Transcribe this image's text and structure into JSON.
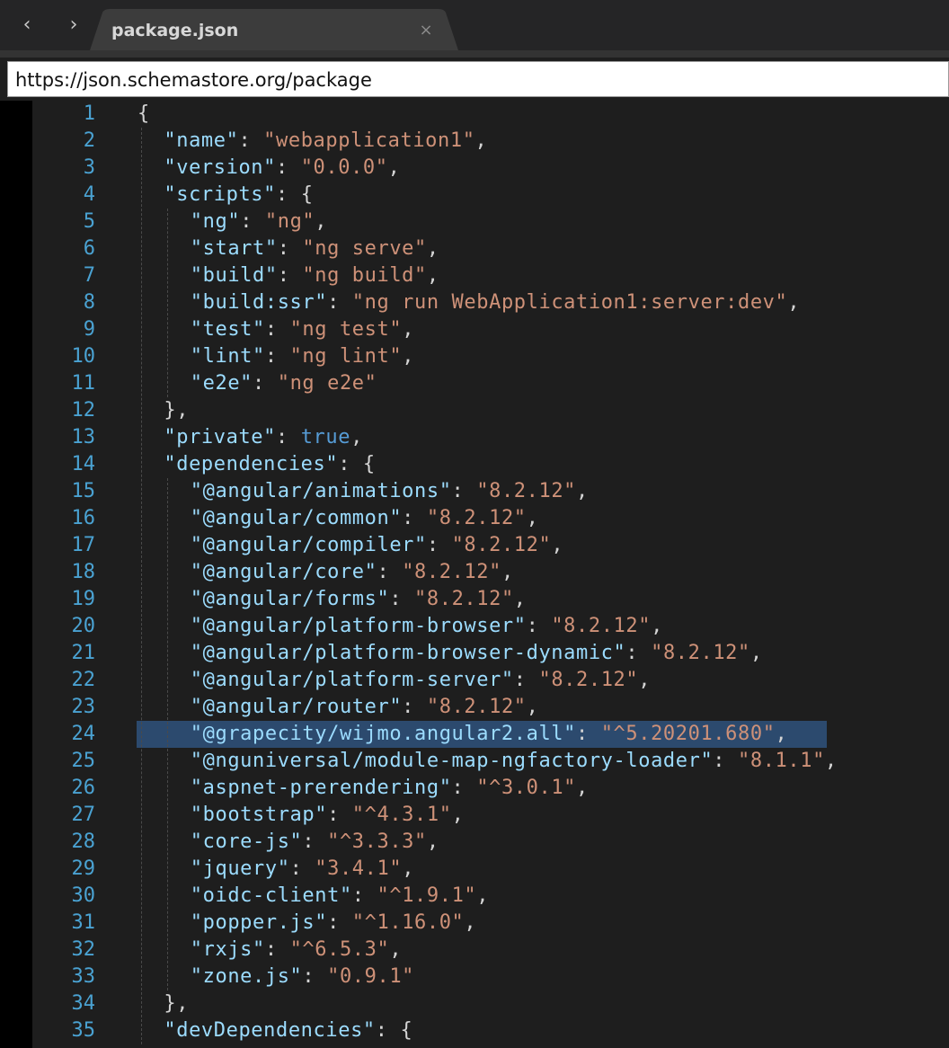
{
  "nav": {
    "back_glyph": "‹",
    "forward_glyph": "›",
    "back_icon": "chevron-left-icon",
    "forward_icon": "chevron-right-icon"
  },
  "tab": {
    "title": "package.json",
    "close_glyph": "×",
    "close_icon": "close-icon"
  },
  "schema_url": "https://json.schemastore.org/package",
  "colors": {
    "key": "#9cdcfe",
    "string": "#ce9178",
    "punct": "#d4d4d4",
    "bool": "#569cd6",
    "line_number": "#4aa2d2",
    "selection": "#2c4a6e",
    "editor_bg": "#1e1e1e"
  },
  "highlighted_line": 24,
  "lines": [
    {
      "n": "1",
      "indent": 0,
      "tokens": [
        {
          "t": "{",
          "c": "p"
        }
      ]
    },
    {
      "n": "2",
      "indent": 1,
      "tokens": [
        {
          "t": "\"name\"",
          "c": "k"
        },
        {
          "t": ": ",
          "c": "p"
        },
        {
          "t": "\"webapplication1\"",
          "c": "s"
        },
        {
          "t": ",",
          "c": "p"
        }
      ]
    },
    {
      "n": "3",
      "indent": 1,
      "tokens": [
        {
          "t": "\"version\"",
          "c": "k"
        },
        {
          "t": ": ",
          "c": "p"
        },
        {
          "t": "\"0.0.0\"",
          "c": "s"
        },
        {
          "t": ",",
          "c": "p"
        }
      ]
    },
    {
      "n": "4",
      "indent": 1,
      "tokens": [
        {
          "t": "\"scripts\"",
          "c": "k"
        },
        {
          "t": ": {",
          "c": "p"
        }
      ]
    },
    {
      "n": "5",
      "indent": 2,
      "tokens": [
        {
          "t": "\"ng\"",
          "c": "k"
        },
        {
          "t": ": ",
          "c": "p"
        },
        {
          "t": "\"ng\"",
          "c": "s"
        },
        {
          "t": ",",
          "c": "p"
        }
      ]
    },
    {
      "n": "6",
      "indent": 2,
      "tokens": [
        {
          "t": "\"start\"",
          "c": "k"
        },
        {
          "t": ": ",
          "c": "p"
        },
        {
          "t": "\"ng serve\"",
          "c": "s"
        },
        {
          "t": ",",
          "c": "p"
        }
      ]
    },
    {
      "n": "7",
      "indent": 2,
      "tokens": [
        {
          "t": "\"build\"",
          "c": "k"
        },
        {
          "t": ": ",
          "c": "p"
        },
        {
          "t": "\"ng build\"",
          "c": "s"
        },
        {
          "t": ",",
          "c": "p"
        }
      ]
    },
    {
      "n": "8",
      "indent": 2,
      "tokens": [
        {
          "t": "\"build:ssr\"",
          "c": "k"
        },
        {
          "t": ": ",
          "c": "p"
        },
        {
          "t": "\"ng run WebApplication1:server:dev\"",
          "c": "s"
        },
        {
          "t": ",",
          "c": "p"
        }
      ]
    },
    {
      "n": "9",
      "indent": 2,
      "tokens": [
        {
          "t": "\"test\"",
          "c": "k"
        },
        {
          "t": ": ",
          "c": "p"
        },
        {
          "t": "\"ng test\"",
          "c": "s"
        },
        {
          "t": ",",
          "c": "p"
        }
      ]
    },
    {
      "n": "10",
      "indent": 2,
      "tokens": [
        {
          "t": "\"lint\"",
          "c": "k"
        },
        {
          "t": ": ",
          "c": "p"
        },
        {
          "t": "\"ng lint\"",
          "c": "s"
        },
        {
          "t": ",",
          "c": "p"
        }
      ]
    },
    {
      "n": "11",
      "indent": 2,
      "tokens": [
        {
          "t": "\"e2e\"",
          "c": "k"
        },
        {
          "t": ": ",
          "c": "p"
        },
        {
          "t": "\"ng e2e\"",
          "c": "s"
        }
      ]
    },
    {
      "n": "12",
      "indent": 1,
      "tokens": [
        {
          "t": "},",
          "c": "p"
        }
      ]
    },
    {
      "n": "13",
      "indent": 1,
      "tokens": [
        {
          "t": "\"private\"",
          "c": "k"
        },
        {
          "t": ": ",
          "c": "p"
        },
        {
          "t": "true",
          "c": "b"
        },
        {
          "t": ",",
          "c": "p"
        }
      ]
    },
    {
      "n": "14",
      "indent": 1,
      "tokens": [
        {
          "t": "\"dependencies\"",
          "c": "k"
        },
        {
          "t": ": {",
          "c": "p"
        }
      ]
    },
    {
      "n": "15",
      "indent": 2,
      "tokens": [
        {
          "t": "\"@angular/animations\"",
          "c": "k"
        },
        {
          "t": ": ",
          "c": "p"
        },
        {
          "t": "\"8.2.12\"",
          "c": "s"
        },
        {
          "t": ",",
          "c": "p"
        }
      ]
    },
    {
      "n": "16",
      "indent": 2,
      "tokens": [
        {
          "t": "\"@angular/common\"",
          "c": "k"
        },
        {
          "t": ": ",
          "c": "p"
        },
        {
          "t": "\"8.2.12\"",
          "c": "s"
        },
        {
          "t": ",",
          "c": "p"
        }
      ]
    },
    {
      "n": "17",
      "indent": 2,
      "tokens": [
        {
          "t": "\"@angular/compiler\"",
          "c": "k"
        },
        {
          "t": ": ",
          "c": "p"
        },
        {
          "t": "\"8.2.12\"",
          "c": "s"
        },
        {
          "t": ",",
          "c": "p"
        }
      ]
    },
    {
      "n": "18",
      "indent": 2,
      "tokens": [
        {
          "t": "\"@angular/core\"",
          "c": "k"
        },
        {
          "t": ": ",
          "c": "p"
        },
        {
          "t": "\"8.2.12\"",
          "c": "s"
        },
        {
          "t": ",",
          "c": "p"
        }
      ]
    },
    {
      "n": "19",
      "indent": 2,
      "tokens": [
        {
          "t": "\"@angular/forms\"",
          "c": "k"
        },
        {
          "t": ": ",
          "c": "p"
        },
        {
          "t": "\"8.2.12\"",
          "c": "s"
        },
        {
          "t": ",",
          "c": "p"
        }
      ]
    },
    {
      "n": "20",
      "indent": 2,
      "tokens": [
        {
          "t": "\"@angular/platform-browser\"",
          "c": "k"
        },
        {
          "t": ": ",
          "c": "p"
        },
        {
          "t": "\"8.2.12\"",
          "c": "s"
        },
        {
          "t": ",",
          "c": "p"
        }
      ]
    },
    {
      "n": "21",
      "indent": 2,
      "tokens": [
        {
          "t": "\"@angular/platform-browser-dynamic\"",
          "c": "k"
        },
        {
          "t": ": ",
          "c": "p"
        },
        {
          "t": "\"8.2.12\"",
          "c": "s"
        },
        {
          "t": ",",
          "c": "p"
        }
      ]
    },
    {
      "n": "22",
      "indent": 2,
      "tokens": [
        {
          "t": "\"@angular/platform-server\"",
          "c": "k"
        },
        {
          "t": ": ",
          "c": "p"
        },
        {
          "t": "\"8.2.12\"",
          "c": "s"
        },
        {
          "t": ",",
          "c": "p"
        }
      ]
    },
    {
      "n": "23",
      "indent": 2,
      "tokens": [
        {
          "t": "\"@angular/router\"",
          "c": "k"
        },
        {
          "t": ": ",
          "c": "p"
        },
        {
          "t": "\"8.2.12\"",
          "c": "s"
        },
        {
          "t": ",",
          "c": "p"
        }
      ]
    },
    {
      "n": "24",
      "indent": 2,
      "tokens": [
        {
          "t": "\"@grapecity/wijmo.angular2.all\"",
          "c": "k"
        },
        {
          "t": ": ",
          "c": "p"
        },
        {
          "t": "\"^5.20201.680\"",
          "c": "s"
        },
        {
          "t": ",",
          "c": "p"
        }
      ]
    },
    {
      "n": "25",
      "indent": 2,
      "tokens": [
        {
          "t": "\"@nguniversal/module-map-ngfactory-loader\"",
          "c": "k"
        },
        {
          "t": ": ",
          "c": "p"
        },
        {
          "t": "\"8.1.1\"",
          "c": "s"
        },
        {
          "t": ",",
          "c": "p"
        }
      ]
    },
    {
      "n": "26",
      "indent": 2,
      "tokens": [
        {
          "t": "\"aspnet-prerendering\"",
          "c": "k"
        },
        {
          "t": ": ",
          "c": "p"
        },
        {
          "t": "\"^3.0.1\"",
          "c": "s"
        },
        {
          "t": ",",
          "c": "p"
        }
      ]
    },
    {
      "n": "27",
      "indent": 2,
      "tokens": [
        {
          "t": "\"bootstrap\"",
          "c": "k"
        },
        {
          "t": ": ",
          "c": "p"
        },
        {
          "t": "\"^4.3.1\"",
          "c": "s"
        },
        {
          "t": ",",
          "c": "p"
        }
      ]
    },
    {
      "n": "28",
      "indent": 2,
      "tokens": [
        {
          "t": "\"core-js\"",
          "c": "k"
        },
        {
          "t": ": ",
          "c": "p"
        },
        {
          "t": "\"^3.3.3\"",
          "c": "s"
        },
        {
          "t": ",",
          "c": "p"
        }
      ]
    },
    {
      "n": "29",
      "indent": 2,
      "tokens": [
        {
          "t": "\"jquery\"",
          "c": "k"
        },
        {
          "t": ": ",
          "c": "p"
        },
        {
          "t": "\"3.4.1\"",
          "c": "s"
        },
        {
          "t": ",",
          "c": "p"
        }
      ]
    },
    {
      "n": "30",
      "indent": 2,
      "tokens": [
        {
          "t": "\"oidc-client\"",
          "c": "k"
        },
        {
          "t": ": ",
          "c": "p"
        },
        {
          "t": "\"^1.9.1\"",
          "c": "s"
        },
        {
          "t": ",",
          "c": "p"
        }
      ]
    },
    {
      "n": "31",
      "indent": 2,
      "tokens": [
        {
          "t": "\"popper.js\"",
          "c": "k"
        },
        {
          "t": ": ",
          "c": "p"
        },
        {
          "t": "\"^1.16.0\"",
          "c": "s"
        },
        {
          "t": ",",
          "c": "p"
        }
      ]
    },
    {
      "n": "32",
      "indent": 2,
      "tokens": [
        {
          "t": "\"rxjs\"",
          "c": "k"
        },
        {
          "t": ": ",
          "c": "p"
        },
        {
          "t": "\"^6.5.3\"",
          "c": "s"
        },
        {
          "t": ",",
          "c": "p"
        }
      ]
    },
    {
      "n": "33",
      "indent": 2,
      "tokens": [
        {
          "t": "\"zone.js\"",
          "c": "k"
        },
        {
          "t": ": ",
          "c": "p"
        },
        {
          "t": "\"0.9.1\"",
          "c": "s"
        }
      ]
    },
    {
      "n": "34",
      "indent": 1,
      "tokens": [
        {
          "t": "},",
          "c": "p"
        }
      ]
    },
    {
      "n": "35",
      "indent": 1,
      "tokens": [
        {
          "t": "\"devDependencies\"",
          "c": "k"
        },
        {
          "t": ": {",
          "c": "p"
        }
      ]
    }
  ]
}
